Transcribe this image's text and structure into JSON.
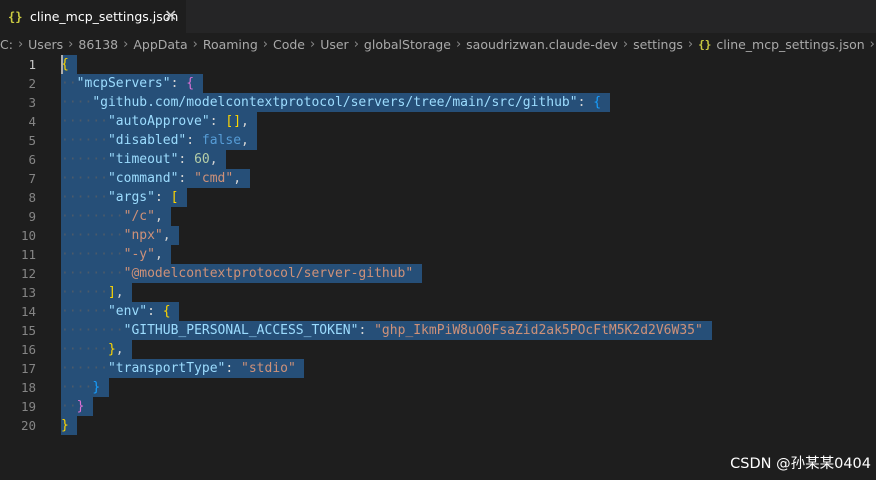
{
  "tab": {
    "icon": "{}",
    "label": "cline_mcp_settings.json",
    "close_glyph": "✕"
  },
  "breadcrumb": [
    {
      "label": "C:",
      "file": false
    },
    {
      "label": "Users",
      "file": false
    },
    {
      "label": "86138",
      "file": false
    },
    {
      "label": "AppData",
      "file": false
    },
    {
      "label": "Roaming",
      "file": false
    },
    {
      "label": "Code",
      "file": false
    },
    {
      "label": "User",
      "file": false
    },
    {
      "label": "globalStorage",
      "file": false
    },
    {
      "label": "saoudrizwan.claude-dev",
      "file": false
    },
    {
      "label": "settings",
      "file": false
    },
    {
      "label": "cline_mcp_settings.json",
      "file": true,
      "icon": "{}"
    },
    {
      "label": "...",
      "file": false
    }
  ],
  "code_lines": [
    {
      "n": "1",
      "indent": 0,
      "tokens": [
        {
          "t": "{",
          "c": "br1"
        }
      ]
    },
    {
      "n": "2",
      "indent": 1,
      "tokens": [
        {
          "t": "\"mcpServers\"",
          "c": "key"
        },
        {
          "t": ": ",
          "c": "punc"
        },
        {
          "t": "{",
          "c": "br2"
        }
      ]
    },
    {
      "n": "3",
      "indent": 2,
      "tokens": [
        {
          "t": "\"github.com/modelcontextprotocol/servers/tree/main/src/github\"",
          "c": "key"
        },
        {
          "t": ": ",
          "c": "punc"
        },
        {
          "t": "{",
          "c": "br3"
        }
      ]
    },
    {
      "n": "4",
      "indent": 3,
      "tokens": [
        {
          "t": "\"autoApprove\"",
          "c": "key"
        },
        {
          "t": ": ",
          "c": "punc"
        },
        {
          "t": "[]",
          "c": "br1"
        },
        {
          "t": ",",
          "c": "punc"
        }
      ]
    },
    {
      "n": "5",
      "indent": 3,
      "tokens": [
        {
          "t": "\"disabled\"",
          "c": "key"
        },
        {
          "t": ": ",
          "c": "punc"
        },
        {
          "t": "false",
          "c": "kw"
        },
        {
          "t": ",",
          "c": "punc"
        }
      ]
    },
    {
      "n": "6",
      "indent": 3,
      "tokens": [
        {
          "t": "\"timeout\"",
          "c": "key"
        },
        {
          "t": ": ",
          "c": "punc"
        },
        {
          "t": "60",
          "c": "num"
        },
        {
          "t": ",",
          "c": "punc"
        }
      ]
    },
    {
      "n": "7",
      "indent": 3,
      "tokens": [
        {
          "t": "\"command\"",
          "c": "key"
        },
        {
          "t": ": ",
          "c": "punc"
        },
        {
          "t": "\"cmd\"",
          "c": "str"
        },
        {
          "t": ",",
          "c": "punc"
        }
      ]
    },
    {
      "n": "8",
      "indent": 3,
      "tokens": [
        {
          "t": "\"args\"",
          "c": "key"
        },
        {
          "t": ": ",
          "c": "punc"
        },
        {
          "t": "[",
          "c": "br1"
        }
      ]
    },
    {
      "n": "9",
      "indent": 4,
      "tokens": [
        {
          "t": "\"/c\"",
          "c": "str"
        },
        {
          "t": ",",
          "c": "punc"
        }
      ]
    },
    {
      "n": "10",
      "indent": 4,
      "tokens": [
        {
          "t": "\"npx\"",
          "c": "str"
        },
        {
          "t": ",",
          "c": "punc"
        }
      ]
    },
    {
      "n": "11",
      "indent": 4,
      "tokens": [
        {
          "t": "\"-y\"",
          "c": "str"
        },
        {
          "t": ",",
          "c": "punc"
        }
      ]
    },
    {
      "n": "12",
      "indent": 4,
      "tokens": [
        {
          "t": "\"@modelcontextprotocol/server-github\"",
          "c": "str"
        }
      ]
    },
    {
      "n": "13",
      "indent": 3,
      "tokens": [
        {
          "t": "]",
          "c": "br1"
        },
        {
          "t": ",",
          "c": "punc"
        }
      ]
    },
    {
      "n": "14",
      "indent": 3,
      "tokens": [
        {
          "t": "\"env\"",
          "c": "key"
        },
        {
          "t": ": ",
          "c": "punc"
        },
        {
          "t": "{",
          "c": "br1"
        }
      ]
    },
    {
      "n": "15",
      "indent": 4,
      "tokens": [
        {
          "t": "\"GITHUB_PERSONAL_ACCESS_TOKEN\"",
          "c": "key"
        },
        {
          "t": ": ",
          "c": "punc"
        },
        {
          "t": "\"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\"",
          "c": "str"
        }
      ]
    },
    {
      "n": "16",
      "indent": 3,
      "tokens": [
        {
          "t": "}",
          "c": "br1"
        },
        {
          "t": ",",
          "c": "punc"
        }
      ]
    },
    {
      "n": "17",
      "indent": 3,
      "tokens": [
        {
          "t": "\"transportType\"",
          "c": "key"
        },
        {
          "t": ": ",
          "c": "punc"
        },
        {
          "t": "\"stdio\"",
          "c": "str"
        }
      ]
    },
    {
      "n": "18",
      "indent": 2,
      "tokens": [
        {
          "t": "}",
          "c": "br3"
        }
      ]
    },
    {
      "n": "19",
      "indent": 1,
      "tokens": [
        {
          "t": "}",
          "c": "br2"
        }
      ]
    },
    {
      "n": "20",
      "indent": 0,
      "tokens": [
        {
          "t": "}",
          "c": "br1"
        }
      ]
    }
  ],
  "watermark": "CSDN @孙某某0404",
  "colors": {
    "editor_bg": "#1e1e1e",
    "selection": "#264f78",
    "json_key": "#9cdcfe",
    "json_string": "#ce9178",
    "json_number": "#b5cea8",
    "json_keyword": "#569cd6"
  }
}
